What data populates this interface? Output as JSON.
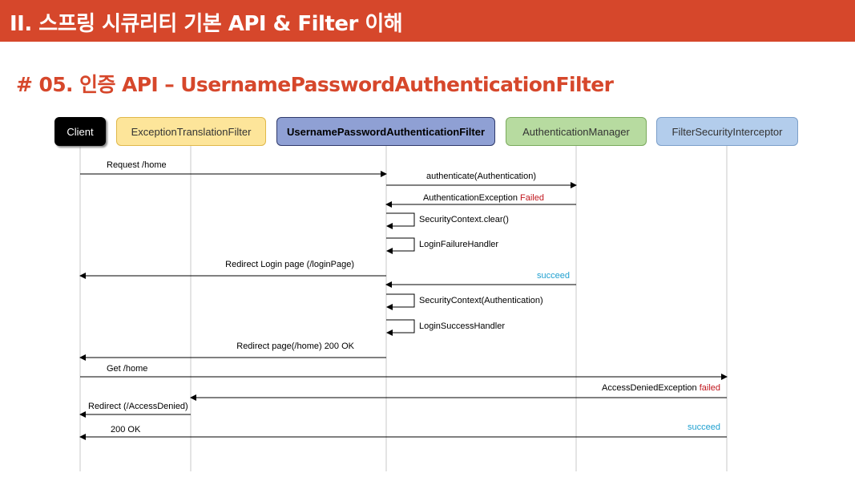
{
  "banner": {
    "title": "II. 스프링 시큐리티 기본 API & Filter 이해"
  },
  "heading": "# 05. 인증 API – UsernamePasswordAuthenticationFilter",
  "actors": [
    {
      "id": "client",
      "label": "Client",
      "bg": "#000000",
      "border": "#000000",
      "color": "#ffffff",
      "bold": false
    },
    {
      "id": "exception-translation-filter",
      "label": "ExceptionTranslationFilter",
      "bg": "#fde59a",
      "border": "#e0b84a",
      "color": "#333333",
      "bold": false
    },
    {
      "id": "username-password-authentication-filter",
      "label": "UsernamePasswordAuthenticationFilter",
      "bg": "#8fa0d4",
      "border": "#2f3a6b",
      "color": "#000000",
      "bold": true
    },
    {
      "id": "authentication-manager",
      "label": "AuthenticationManager",
      "bg": "#b7dba0",
      "border": "#7aaa5c",
      "color": "#333333",
      "bold": false
    },
    {
      "id": "filter-security-interceptor",
      "label": "FilterSecurityInterceptor",
      "bg": "#b3cdec",
      "border": "#7c9fc9",
      "color": "#333333",
      "bold": false
    }
  ],
  "messages": [
    {
      "id": "request-home",
      "from": 0,
      "to": 2,
      "parts": [
        {
          "text": "Request /home"
        }
      ]
    },
    {
      "id": "authenticate",
      "from": 2,
      "to": 3,
      "parts": [
        {
          "text": "authenticate(Authentication)"
        }
      ]
    },
    {
      "id": "authentication-exception",
      "from": 3,
      "to": 2,
      "parts": [
        {
          "text": "AuthenticationException "
        },
        {
          "text": "Failed",
          "color": "#c0161d"
        }
      ]
    },
    {
      "id": "security-context-clear",
      "self": 2,
      "parts": [
        {
          "text": "SecurityContext.clear()"
        }
      ]
    },
    {
      "id": "login-failure-handler",
      "self": 2,
      "parts": [
        {
          "text": "LoginFailureHandler"
        }
      ]
    },
    {
      "id": "redirect-login-page",
      "from": 2,
      "to": 0,
      "parts": [
        {
          "text": "Redirect Login page (/loginPage)"
        }
      ]
    },
    {
      "id": "auth-succeed",
      "from": 3,
      "to": 2,
      "parts": [
        {
          "text": "succeed",
          "color": "#20a0d0"
        }
      ]
    },
    {
      "id": "security-context-set",
      "self": 2,
      "parts": [
        {
          "text": "SecurityContext(Authentication)"
        }
      ]
    },
    {
      "id": "login-success-handler",
      "self": 2,
      "parts": [
        {
          "text": "LoginSuccessHandler"
        }
      ]
    },
    {
      "id": "redirect-home",
      "from": 2,
      "to": 0,
      "parts": [
        {
          "text": "Redirect page(/home)      200 OK"
        }
      ]
    },
    {
      "id": "get-home",
      "from": 0,
      "to": 4,
      "parts": [
        {
          "text": "Get /home"
        }
      ]
    },
    {
      "id": "access-denied-exception",
      "from": 4,
      "to": 1,
      "parts": [
        {
          "text": "AccessDeniedException   "
        },
        {
          "text": "failed",
          "color": "#c0161d"
        }
      ]
    },
    {
      "id": "redirect-access-denied",
      "from": 1,
      "to": 0,
      "parts": [
        {
          "text": "Redirect (/AccessDenied)"
        }
      ]
    },
    {
      "id": "final-200-ok",
      "from": 4,
      "to": 0,
      "parts": [
        {
          "text": "200 OK"
        }
      ]
    },
    {
      "id": "access-succeed",
      "from": 4,
      "to": 0,
      "parts": [
        {
          "text": "succeed",
          "color": "#20a0d0"
        }
      ],
      "labelOnly": true
    }
  ]
}
